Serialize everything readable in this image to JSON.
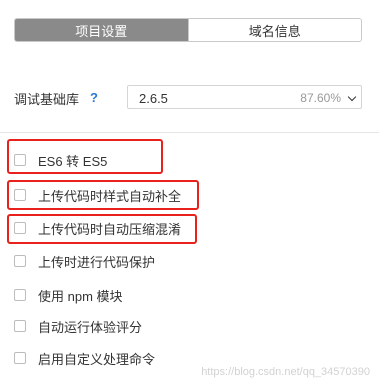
{
  "tabs": [
    {
      "label": "项目设置",
      "active": true
    },
    {
      "label": "域名信息",
      "active": false
    }
  ],
  "base_library": {
    "label": "调试基础库",
    "help_icon": "?",
    "selected_version": "2.6.5",
    "coverage": "87.60%"
  },
  "options": [
    {
      "label": "ES6 转 ES5",
      "checked": false,
      "highlighted": true
    },
    {
      "label": "上传代码时样式自动补全",
      "checked": false,
      "highlighted": true
    },
    {
      "label": "上传代码时自动压缩混淆",
      "checked": false,
      "highlighted": true
    },
    {
      "label": "上传时进行代码保护",
      "checked": false,
      "highlighted": false
    },
    {
      "label": "使用 npm 模块",
      "checked": false,
      "highlighted": false
    },
    {
      "label": "自动运行体验评分",
      "checked": false,
      "highlighted": false
    },
    {
      "label": "启用自定义处理命令",
      "checked": false,
      "highlighted": false
    }
  ],
  "colors": {
    "accent_blue": "#2d77d5",
    "highlight_red": "#e8211c",
    "active_tab": "#8a8a8a"
  },
  "watermark": "https://blog.csdn.net/qq_34570390"
}
